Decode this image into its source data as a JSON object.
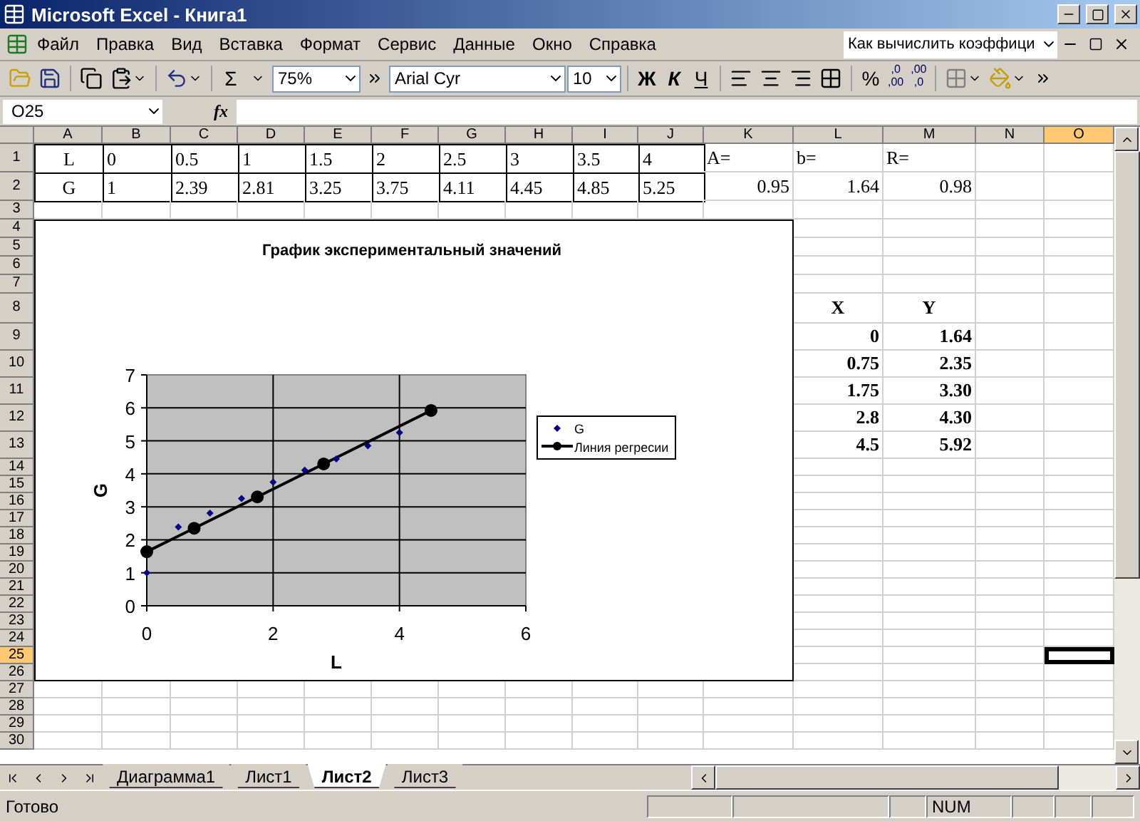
{
  "window": {
    "title": "Microsoft Excel - Книга1"
  },
  "menu": {
    "items": [
      "Файл",
      "Правка",
      "Вид",
      "Вставка",
      "Формат",
      "Сервис",
      "Данные",
      "Окно",
      "Справка"
    ],
    "help_box": {
      "value": "Как вычислить коэффици"
    }
  },
  "toolbar": {
    "sum": "Σ",
    "zoom": "75%",
    "font": "Arial Cyr",
    "size": "10",
    "bold": "Ж",
    "italic": "К",
    "underline": "Ч",
    "percent": "%",
    "increase_decimal": [
      ",0",
      ",00"
    ],
    "decrease_decimal": [
      ",00",
      ",0"
    ]
  },
  "formula_bar": {
    "name_box": "O25",
    "fx": "fx"
  },
  "sheet": {
    "columns": [
      {
        "label": "A",
        "selected": false
      },
      {
        "label": "B",
        "selected": false
      },
      {
        "label": "C",
        "selected": false
      },
      {
        "label": "D",
        "selected": false
      },
      {
        "label": "E",
        "selected": false
      },
      {
        "label": "F",
        "selected": false
      },
      {
        "label": "G",
        "selected": false
      },
      {
        "label": "H",
        "selected": false
      },
      {
        "label": "I",
        "selected": false
      },
      {
        "label": "J",
        "selected": false
      },
      {
        "label": "K",
        "selected": false
      },
      {
        "label": "L",
        "selected": false
      },
      {
        "label": "M",
        "selected": false
      },
      {
        "label": "N",
        "selected": false
      },
      {
        "label": "O",
        "selected": true
      }
    ],
    "rows": [
      {
        "label": "1",
        "selected": false,
        "cells": [
          {
            "text": "L",
            "kind": "label",
            "boxed": true
          },
          {
            "text": "0",
            "kind": "text",
            "boxed": true
          },
          {
            "text": "0.5",
            "kind": "text",
            "boxed": true
          },
          {
            "text": "1",
            "kind": "text",
            "boxed": true
          },
          {
            "text": "1.5",
            "kind": "text",
            "boxed": true
          },
          {
            "text": "2",
            "kind": "text",
            "boxed": true
          },
          {
            "text": "2.5",
            "kind": "text",
            "boxed": true
          },
          {
            "text": "3",
            "kind": "text",
            "boxed": true
          },
          {
            "text": "3.5",
            "kind": "text",
            "boxed": true
          },
          {
            "text": "4",
            "kind": "text",
            "boxed": true
          },
          {
            "text": "A=",
            "kind": "text"
          },
          {
            "text": "b=",
            "kind": "text"
          },
          {
            "text": "R=",
            "kind": "text"
          }
        ]
      },
      {
        "label": "2",
        "selected": false,
        "cells": [
          {
            "text": "G",
            "kind": "label",
            "boxed": true
          },
          {
            "text": "1",
            "kind": "text",
            "boxed": true
          },
          {
            "text": "2.39",
            "kind": "text",
            "boxed": true
          },
          {
            "text": "2.81",
            "kind": "text",
            "boxed": true
          },
          {
            "text": "3.25",
            "kind": "text",
            "boxed": true
          },
          {
            "text": "3.75",
            "kind": "text",
            "boxed": true
          },
          {
            "text": "4.11",
            "kind": "text",
            "boxed": true
          },
          {
            "text": "4.45",
            "kind": "text",
            "boxed": true
          },
          {
            "text": "4.85",
            "kind": "text",
            "boxed": true
          },
          {
            "text": "5.25",
            "kind": "text",
            "boxed": true
          },
          {
            "text": "0.95",
            "kind": "number"
          },
          {
            "text": "1.64",
            "kind": "number"
          },
          {
            "text": "0.98",
            "kind": "number"
          }
        ]
      },
      {
        "label": "3",
        "selected": false
      },
      {
        "label": "4",
        "selected": false
      },
      {
        "label": "5",
        "selected": false
      },
      {
        "label": "6",
        "selected": false
      },
      {
        "label": "7",
        "selected": false
      },
      {
        "label": "8",
        "selected": false,
        "cells": [
          {},
          {},
          {},
          {},
          {},
          {},
          {},
          {},
          {},
          {},
          {},
          {
            "text": "X",
            "kind": "head"
          },
          {
            "text": "Y",
            "kind": "head"
          }
        ]
      },
      {
        "label": "9",
        "selected": false,
        "cells": [
          {},
          {},
          {},
          {},
          {},
          {},
          {},
          {},
          {},
          {},
          {},
          {
            "text": "0",
            "kind": "value"
          },
          {
            "text": "1.64",
            "kind": "value"
          }
        ]
      },
      {
        "label": "10",
        "selected": false,
        "cells": [
          {},
          {},
          {},
          {},
          {},
          {},
          {},
          {},
          {},
          {},
          {},
          {
            "text": "0.75",
            "kind": "value"
          },
          {
            "text": "2.35",
            "kind": "value"
          }
        ]
      },
      {
        "label": "11",
        "selected": false,
        "cells": [
          {},
          {},
          {},
          {},
          {},
          {},
          {},
          {},
          {},
          {},
          {},
          {
            "text": "1.75",
            "kind": "value"
          },
          {
            "text": "3.30",
            "kind": "value"
          }
        ]
      },
      {
        "label": "12",
        "selected": false,
        "cells": [
          {},
          {},
          {},
          {},
          {},
          {},
          {},
          {},
          {},
          {},
          {},
          {
            "text": "2.8",
            "kind": "value"
          },
          {
            "text": "4.30",
            "kind": "value"
          }
        ]
      },
      {
        "label": "13",
        "selected": false,
        "cells": [
          {},
          {},
          {},
          {},
          {},
          {},
          {},
          {},
          {},
          {},
          {},
          {
            "text": "4.5",
            "kind": "value"
          },
          {
            "text": "5.92",
            "kind": "value"
          }
        ]
      },
      {
        "label": "14",
        "selected": false
      },
      {
        "label": "15",
        "selected": false
      },
      {
        "label": "16",
        "selected": false
      },
      {
        "label": "17",
        "selected": false
      },
      {
        "label": "18",
        "selected": false
      },
      {
        "label": "19",
        "selected": false
      },
      {
        "label": "20",
        "selected": false
      },
      {
        "label": "21",
        "selected": false
      },
      {
        "label": "22",
        "selected": false
      },
      {
        "label": "23",
        "selected": false
      },
      {
        "label": "24",
        "selected": false
      },
      {
        "label": "25",
        "selected": true,
        "cells": [
          {},
          {},
          {},
          {},
          {},
          {},
          {},
          {},
          {},
          {},
          {},
          {},
          {},
          {},
          {
            "selected": true
          }
        ]
      },
      {
        "label": "26",
        "selected": false
      },
      {
        "label": "27",
        "selected": false
      },
      {
        "label": "28",
        "selected": false
      },
      {
        "label": "29",
        "selected": false
      },
      {
        "label": "30",
        "selected": false
      }
    ]
  },
  "chart": {
    "chart_data": {
      "type": "scatter",
      "title": "График экспериментальный значений",
      "xlabel": "L",
      "ylabel": "G",
      "xlim": [
        0,
        6
      ],
      "ylim": [
        0,
        7
      ],
      "xticks": [
        {
          "value": 0,
          "label": "0"
        },
        {
          "value": 2,
          "label": "2"
        },
        {
          "value": 4,
          "label": "4"
        },
        {
          "value": 6,
          "label": "6"
        }
      ],
      "yticks": [
        {
          "value": 0,
          "label": "0"
        },
        {
          "value": 1,
          "label": "1"
        },
        {
          "value": 2,
          "label": "2"
        },
        {
          "value": 3,
          "label": "3"
        },
        {
          "value": 4,
          "label": "4"
        },
        {
          "value": 5,
          "label": "5"
        },
        {
          "value": 6,
          "label": "6"
        },
        {
          "value": 7,
          "label": "7"
        }
      ],
      "grid": true,
      "legend": true,
      "series": [
        {
          "name": "G",
          "type": "scatter",
          "color": "#000080",
          "x": [
            0,
            0.5,
            1,
            1.5,
            2,
            2.5,
            3,
            3.5,
            4
          ],
          "values": [
            1,
            2.39,
            2.81,
            3.25,
            3.75,
            4.11,
            4.45,
            4.85,
            5.25
          ]
        },
        {
          "name": "Линия регресии",
          "type": "line",
          "marker": "circle",
          "color": "#000000",
          "x": [
            0,
            0.75,
            1.75,
            2.8,
            4.5
          ],
          "values": [
            1.64,
            2.35,
            3.3,
            4.3,
            5.92
          ]
        }
      ]
    }
  },
  "sheet_tabs": [
    {
      "label": "Диаграмма1",
      "selected": false
    },
    {
      "label": "Лист1",
      "selected": false
    },
    {
      "label": "Лист2",
      "selected": true
    },
    {
      "label": "Лист3",
      "selected": false
    }
  ],
  "status_bar": {
    "text": "Готово",
    "num": "NUM"
  }
}
